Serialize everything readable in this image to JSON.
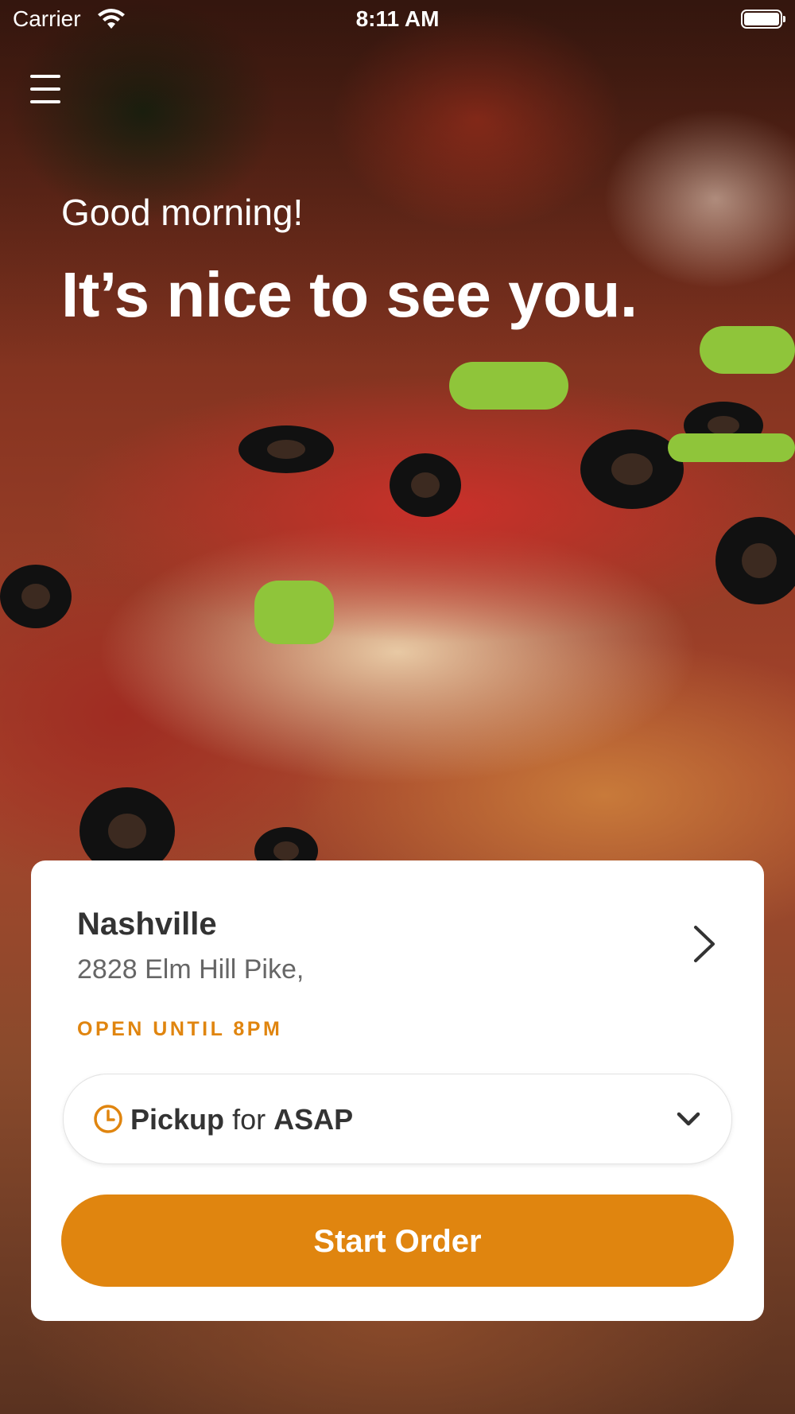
{
  "status_bar": {
    "carrier": "Carrier",
    "time": "8:11 AM"
  },
  "hero": {
    "greeting": "Good morning!",
    "headline": "It’s nice to see you."
  },
  "location": {
    "name": "Nashville",
    "address": "2828 Elm Hill Pike,",
    "hours": "OPEN UNTIL 8PM"
  },
  "order_mode": {
    "mode": "Pickup",
    "connector": "for",
    "time": "ASAP"
  },
  "actions": {
    "start_order": "Start Order"
  },
  "colors": {
    "accent": "#e0850f",
    "text_dark": "#333333",
    "text_muted": "#666666"
  },
  "icons": [
    "wifi-icon",
    "battery-icon",
    "hamburger-menu-icon",
    "chevron-right-icon",
    "clock-icon",
    "chevron-down-icon"
  ]
}
